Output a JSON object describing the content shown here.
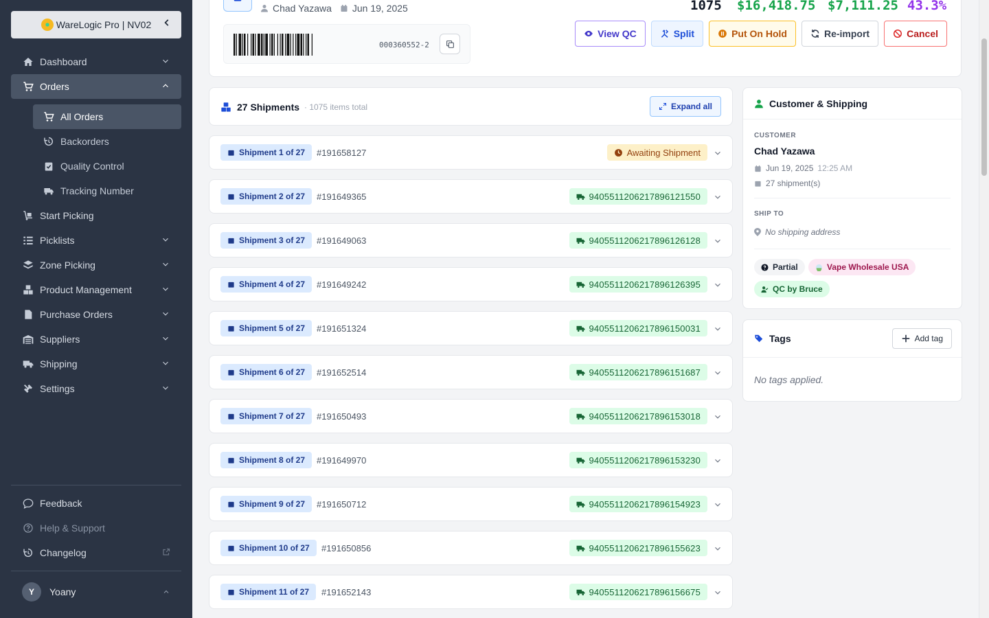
{
  "sidebar": {
    "brand": "WareLogic Pro | NV02",
    "nav": [
      {
        "label": "Dashboard",
        "icon": "home-icon",
        "expandable": true
      },
      {
        "label": "Orders",
        "icon": "cart-icon",
        "expandable": true,
        "active": true
      },
      {
        "label": "Start Picking",
        "icon": "cart-dolly-icon",
        "expandable": false
      },
      {
        "label": "Picklists",
        "icon": "list-icon",
        "expandable": true
      },
      {
        "label": "Zone Picking",
        "icon": "layers-icon",
        "expandable": true
      },
      {
        "label": "Product Management",
        "icon": "boxes-icon",
        "expandable": true
      },
      {
        "label": "Purchase Orders",
        "icon": "file-icon",
        "expandable": true
      },
      {
        "label": "Suppliers",
        "icon": "warehouse-icon",
        "expandable": true
      },
      {
        "label": "Shipping",
        "icon": "truck-icon",
        "expandable": true
      },
      {
        "label": "Settings",
        "icon": "tools-icon",
        "expandable": true
      }
    ],
    "orders_sub": [
      {
        "label": "All Orders",
        "icon": "cart-icon",
        "selected": true
      },
      {
        "label": "Backorders",
        "icon": "history-icon"
      },
      {
        "label": "Quality Control",
        "icon": "clipboard-check-icon"
      },
      {
        "label": "Tracking Number",
        "icon": "truck-fast-icon"
      }
    ],
    "footer": [
      {
        "label": "Feedback",
        "icon": "comment-icon"
      },
      {
        "label": "Help & Support",
        "icon": "question-circle-icon"
      },
      {
        "label": "Changelog",
        "icon": "history-icon"
      }
    ],
    "user": {
      "initial": "Y",
      "name": "Yoany"
    }
  },
  "order": {
    "customer": "Chad Yazawa",
    "date": "Jun 19, 2025",
    "barcode_number": "000360552-2",
    "stats": {
      "items": "1075",
      "total": "$16,418.75",
      "profit": "$7,111.25",
      "margin": "43.3%"
    },
    "actions": {
      "view_qc": "View QC",
      "split": "Split",
      "hold": "Put On Hold",
      "reimport": "Re-import",
      "cancel": "Cancel"
    }
  },
  "shipments": {
    "title": "27 Shipments",
    "subtitle": "· 1075 items total",
    "expand_label": "Expand all",
    "rows": [
      {
        "label": "Shipment 1 of 27",
        "id": "#191658127",
        "status": "Awaiting Shipment",
        "type": "await"
      },
      {
        "label": "Shipment 2 of 27",
        "id": "#191649365",
        "status": "9405511206217896121550",
        "type": "track"
      },
      {
        "label": "Shipment 3 of 27",
        "id": "#191649063",
        "status": "9405511206217896126128",
        "type": "track"
      },
      {
        "label": "Shipment 4 of 27",
        "id": "#191649242",
        "status": "9405511206217896126395",
        "type": "track"
      },
      {
        "label": "Shipment 5 of 27",
        "id": "#191651324",
        "status": "9405511206217896150031",
        "type": "track"
      },
      {
        "label": "Shipment 6 of 27",
        "id": "#191652514",
        "status": "9405511206217896151687",
        "type": "track"
      },
      {
        "label": "Shipment 7 of 27",
        "id": "#191650493",
        "status": "9405511206217896153018",
        "type": "track"
      },
      {
        "label": "Shipment 8 of 27",
        "id": "#191649970",
        "status": "9405511206217896153230",
        "type": "track"
      },
      {
        "label": "Shipment 9 of 27",
        "id": "#191650712",
        "status": "9405511206217896154923",
        "type": "track"
      },
      {
        "label": "Shipment 10 of 27",
        "id": "#191650856",
        "status": "9405511206217896155623",
        "type": "track"
      },
      {
        "label": "Shipment 11 of 27",
        "id": "#191652143",
        "status": "9405511206217896156675",
        "type": "track"
      }
    ]
  },
  "customer_card": {
    "title": "Customer & Shipping",
    "customer_label": "CUSTOMER",
    "name": "Chad Yazawa",
    "date": "Jun 19, 2025",
    "time": "12:25 AM",
    "shipments": "27 shipment(s)",
    "ship_to_label": "SHIP TO",
    "no_address": "No shipping address",
    "tags": [
      "Partial",
      "Vape Wholesale USA",
      "QC by Bruce"
    ]
  },
  "tags_card": {
    "title": "Tags",
    "add_label": "Add tag",
    "empty": "No tags applied."
  },
  "colors": {
    "sidebar_bg": "#2b3444",
    "total_green": "#16a34a",
    "margin_purple": "#9333ea",
    "accent_blue": "#1d4ed8"
  }
}
